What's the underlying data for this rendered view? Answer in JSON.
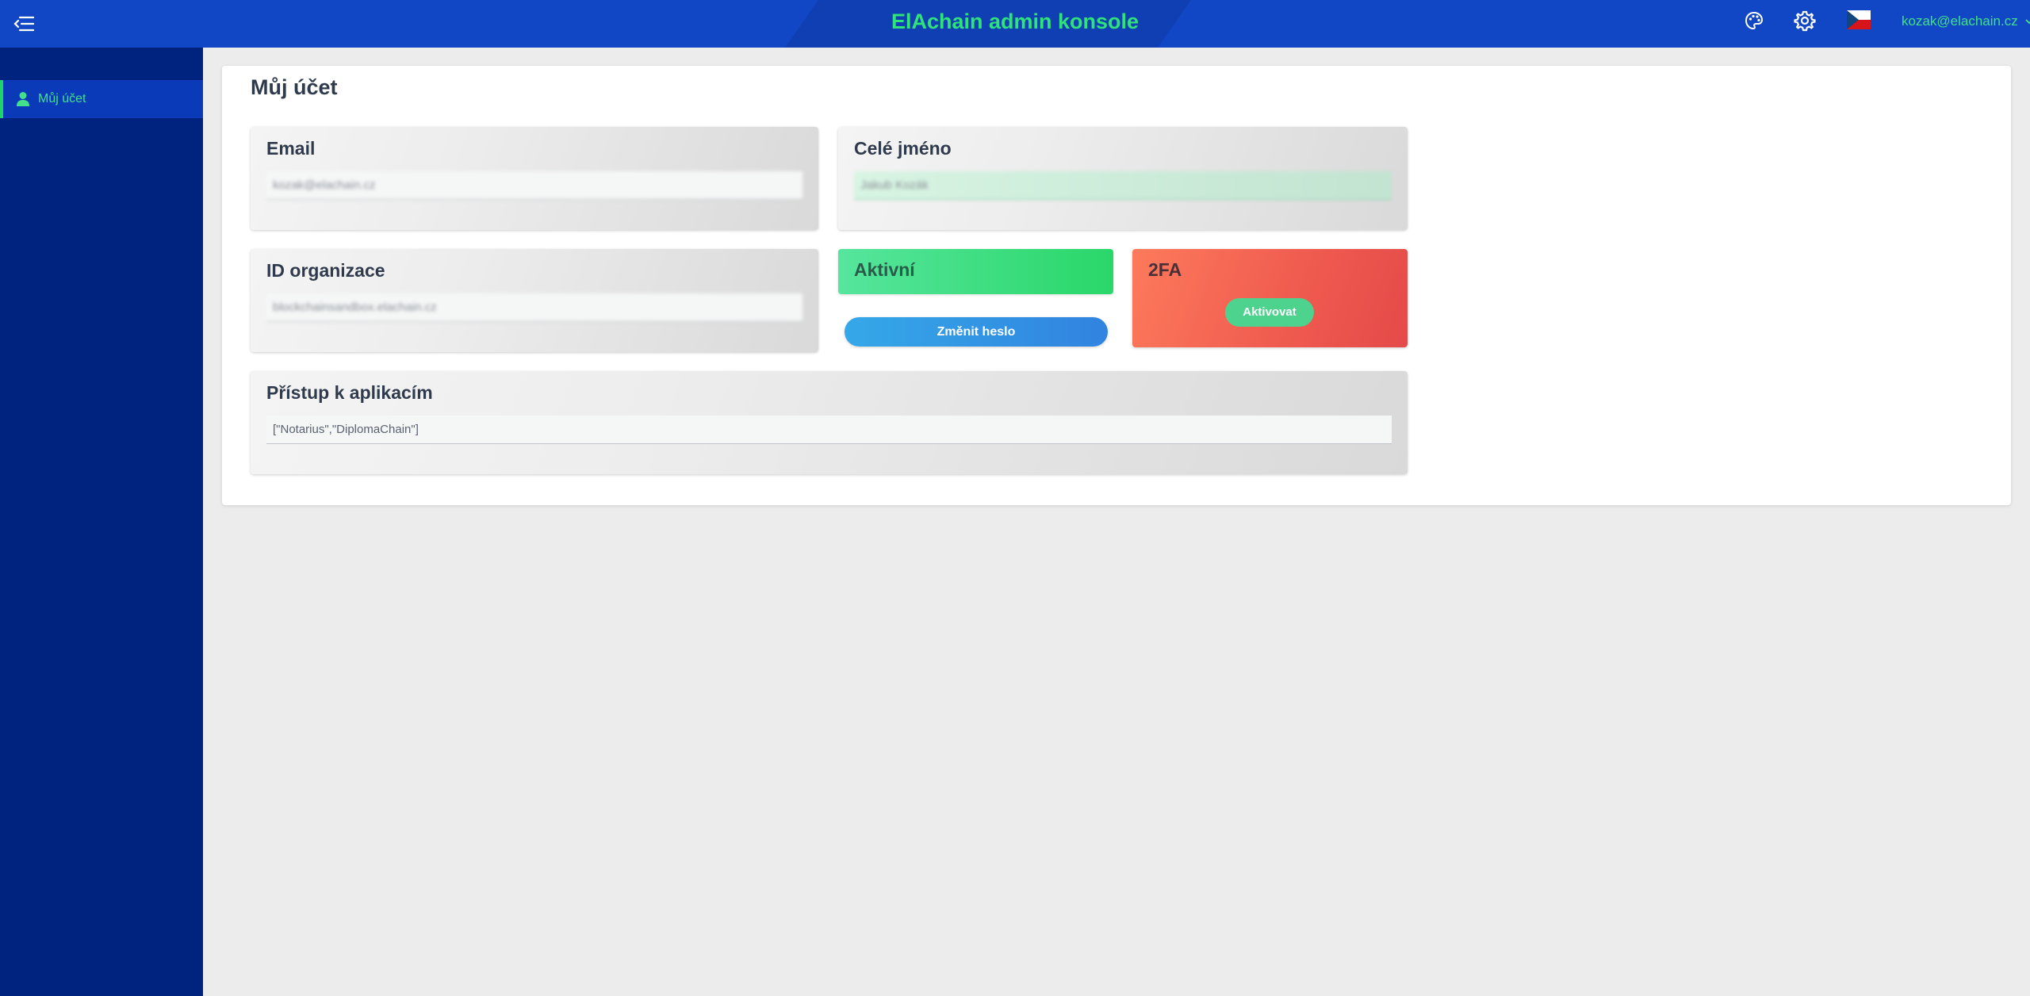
{
  "header": {
    "title": "ElAchain admin konsole",
    "user": "kozak@elachain.cz",
    "icons": [
      "menu-toggle-icon",
      "palette-icon",
      "gear-icon",
      "czech-flag-icon",
      "chevron-down-icon"
    ],
    "colors": {
      "bar": "#1147c4",
      "title": "#2fe27a"
    }
  },
  "sidebar": {
    "items": [
      {
        "label": "Můj účet",
        "icon": "user-icon",
        "active": true
      }
    ],
    "colors": {
      "background": "#00237f",
      "active_accent": "#1ed36a"
    }
  },
  "main": {
    "title": "Můj účet",
    "email": {
      "label": "Email",
      "value": "kozak@elachain.cz"
    },
    "full_name": {
      "label": "Celé jméno",
      "value": "Jakub Kozák"
    },
    "org_id": {
      "label": "ID organizace",
      "value": "blockchainsandbox.elachain.cz"
    },
    "status": {
      "label": "Aktivní"
    },
    "change_password": {
      "label": "Změnit heslo"
    },
    "twofa": {
      "label": "2FA",
      "button": "Aktivovat"
    },
    "app_access": {
      "label": "Přístup k aplikacím",
      "value": "[\"Notarius\",\"DiplomaChain\"]"
    }
  }
}
